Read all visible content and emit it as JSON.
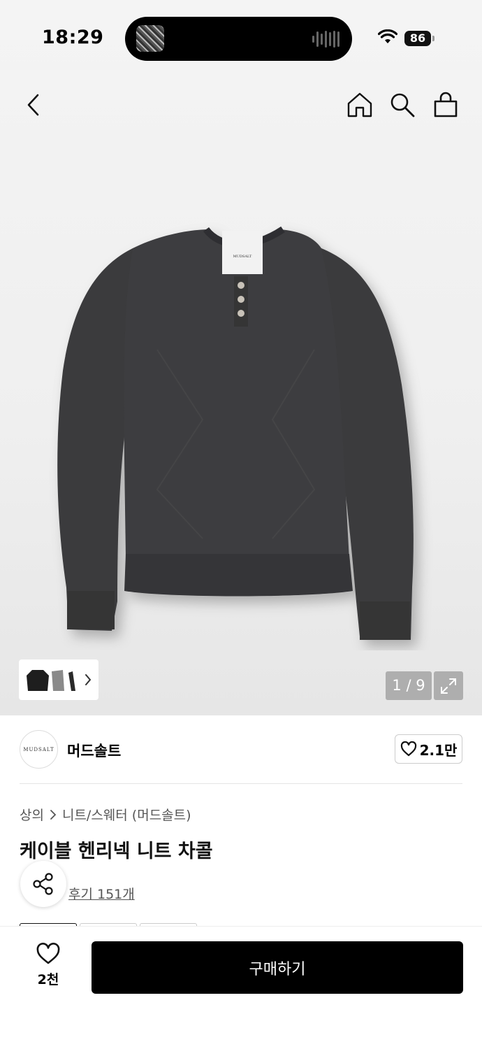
{
  "status_bar": {
    "time": "18:29",
    "battery": "86"
  },
  "nav": {
    "icons": [
      "back-icon",
      "home-icon",
      "search-icon",
      "shopping-bag-icon"
    ]
  },
  "product_image": {
    "tag_text": "MUDSALT",
    "pager": "1 / 9"
  },
  "brand": {
    "logo_text": "MUDSALT",
    "name": "머드솔트",
    "likes": "2.1만"
  },
  "breadcrumb": {
    "category": "상의",
    "subcategory": "니트/스웨터 (머드솔트)"
  },
  "product": {
    "title": "케이블 헨리넥 니트 차콜",
    "review_link": "후기 151개"
  },
  "bottom_bar": {
    "like_count": "2천",
    "buy_label": "구매하기"
  }
}
